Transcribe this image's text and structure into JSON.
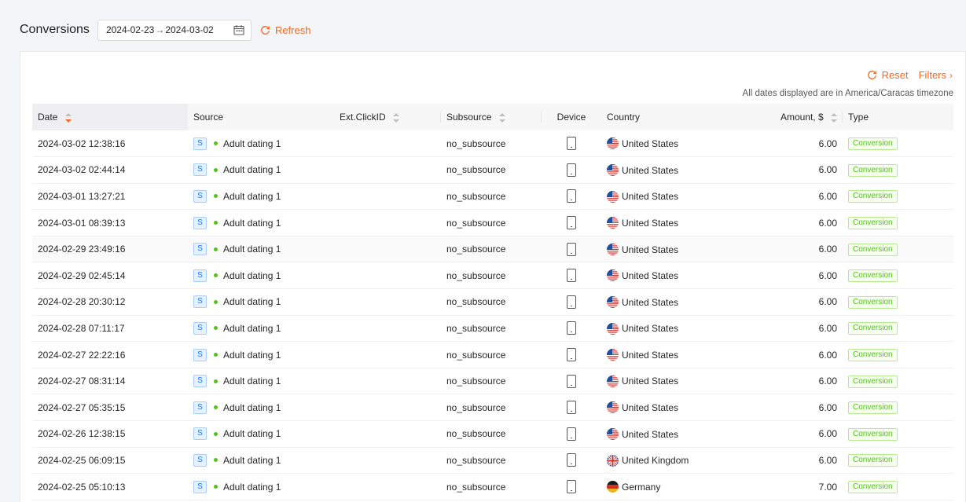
{
  "header": {
    "title": "Conversions",
    "date_start": "2024-02-23",
    "date_sep": "→",
    "date_end": "2024-03-02",
    "refresh_label": "Refresh"
  },
  "toolbar": {
    "reset_label": "Reset",
    "filters_label": "Filters",
    "timezone_note": "All dates displayed are in America/Caracas timezone"
  },
  "colors": {
    "accent": "#f06a24",
    "status_green": "#52c41a",
    "badge_blue": "#1677ff"
  },
  "table": {
    "columns": {
      "date": "Date",
      "source": "Source",
      "ext_click_id": "Ext.ClickID",
      "subsource": "Subsource",
      "device": "Device",
      "country": "Country",
      "amount": "Amount, $",
      "type": "Type"
    },
    "rows": [
      {
        "date": "2024-03-02 12:38:16",
        "source_badge": "S",
        "source": "Adult dating 1",
        "ext_click_id": "",
        "subsource": "no_subsource",
        "device_icon": "mobile-icon",
        "country_flag": "us",
        "country": "United States",
        "amount": "6.00",
        "type": "Conversion"
      },
      {
        "date": "2024-03-02 02:44:14",
        "source_badge": "S",
        "source": "Adult dating 1",
        "ext_click_id": "",
        "subsource": "no_subsource",
        "device_icon": "mobile-icon",
        "country_flag": "us",
        "country": "United States",
        "amount": "6.00",
        "type": "Conversion"
      },
      {
        "date": "2024-03-01 13:27:21",
        "source_badge": "S",
        "source": "Adult dating 1",
        "ext_click_id": "",
        "subsource": "no_subsource",
        "device_icon": "mobile-icon",
        "country_flag": "us",
        "country": "United States",
        "amount": "6.00",
        "type": "Conversion"
      },
      {
        "date": "2024-03-01 08:39:13",
        "source_badge": "S",
        "source": "Adult dating 1",
        "ext_click_id": "",
        "subsource": "no_subsource",
        "device_icon": "mobile-icon",
        "country_flag": "us",
        "country": "United States",
        "amount": "6.00",
        "type": "Conversion"
      },
      {
        "date": "2024-02-29 23:49:16",
        "source_badge": "S",
        "source": "Adult dating 1",
        "ext_click_id": "",
        "subsource": "no_subsource",
        "device_icon": "mobile-icon",
        "country_flag": "us",
        "country": "United States",
        "amount": "6.00",
        "type": "Conversion"
      },
      {
        "date": "2024-02-29 02:45:14",
        "source_badge": "S",
        "source": "Adult dating 1",
        "ext_click_id": "",
        "subsource": "no_subsource",
        "device_icon": "mobile-icon",
        "country_flag": "us",
        "country": "United States",
        "amount": "6.00",
        "type": "Conversion"
      },
      {
        "date": "2024-02-28 20:30:12",
        "source_badge": "S",
        "source": "Adult dating 1",
        "ext_click_id": "",
        "subsource": "no_subsource",
        "device_icon": "mobile-icon",
        "country_flag": "us",
        "country": "United States",
        "amount": "6.00",
        "type": "Conversion"
      },
      {
        "date": "2024-02-28 07:11:17",
        "source_badge": "S",
        "source": "Adult dating 1",
        "ext_click_id": "",
        "subsource": "no_subsource",
        "device_icon": "mobile-icon",
        "country_flag": "us",
        "country": "United States",
        "amount": "6.00",
        "type": "Conversion"
      },
      {
        "date": "2024-02-27 22:22:16",
        "source_badge": "S",
        "source": "Adult dating 1",
        "ext_click_id": "",
        "subsource": "no_subsource",
        "device_icon": "mobile-icon",
        "country_flag": "us",
        "country": "United States",
        "amount": "6.00",
        "type": "Conversion"
      },
      {
        "date": "2024-02-27 08:31:14",
        "source_badge": "S",
        "source": "Adult dating 1",
        "ext_click_id": "",
        "subsource": "no_subsource",
        "device_icon": "mobile-icon",
        "country_flag": "us",
        "country": "United States",
        "amount": "6.00",
        "type": "Conversion"
      },
      {
        "date": "2024-02-27 05:35:15",
        "source_badge": "S",
        "source": "Adult dating 1",
        "ext_click_id": "",
        "subsource": "no_subsource",
        "device_icon": "mobile-icon",
        "country_flag": "us",
        "country": "United States",
        "amount": "6.00",
        "type": "Conversion"
      },
      {
        "date": "2024-02-26 12:38:15",
        "source_badge": "S",
        "source": "Adult dating 1",
        "ext_click_id": "",
        "subsource": "no_subsource",
        "device_icon": "mobile-icon",
        "country_flag": "us",
        "country": "United States",
        "amount": "6.00",
        "type": "Conversion"
      },
      {
        "date": "2024-02-25 06:09:15",
        "source_badge": "S",
        "source": "Adult dating 1",
        "ext_click_id": "",
        "subsource": "no_subsource",
        "device_icon": "mobile-icon",
        "country_flag": "gb",
        "country": "United Kingdom",
        "amount": "6.00",
        "type": "Conversion"
      },
      {
        "date": "2024-02-25 05:10:13",
        "source_badge": "S",
        "source": "Adult dating 1",
        "ext_click_id": "",
        "subsource": "no_subsource",
        "device_icon": "mobile-icon",
        "country_flag": "de",
        "country": "Germany",
        "amount": "7.00",
        "type": "Conversion"
      }
    ]
  }
}
